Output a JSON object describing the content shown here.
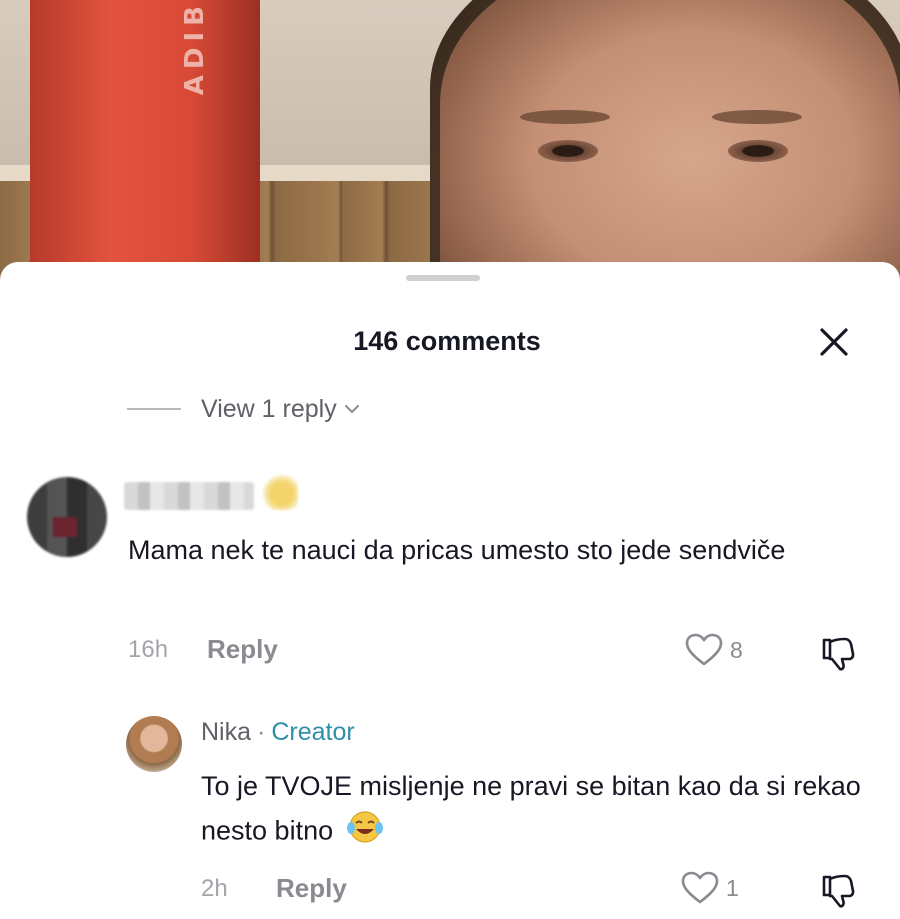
{
  "sheet": {
    "title": "146 comments",
    "view_replies_label": "View 1 reply"
  },
  "comments": [
    {
      "username": "",
      "text": "Mama nek te nauci da pricas umesto sto jede sendviče",
      "time": "16h",
      "reply_label": "Reply",
      "likes": "8"
    },
    {
      "username": "Nika",
      "separator": "·",
      "badge": "Creator",
      "text": "To je TVOJE misljenje ne pravi se bitan kao da si rekao nesto bitno",
      "emoji": "laughing-tears-emoji",
      "time": "2h",
      "reply_label": "Reply",
      "likes": "1"
    }
  ],
  "video": {
    "bottle_text": "ADIB"
  },
  "colors": {
    "creator_badge": "#2f8eaa",
    "text_primary": "#161823",
    "text_secondary": "#8a8b91"
  }
}
